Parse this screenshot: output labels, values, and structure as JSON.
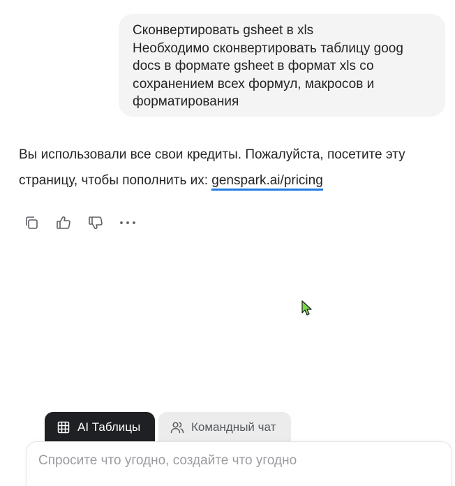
{
  "user_message": {
    "lines": [
      "Сконвертировать gsheet в xls",
      "Необходимо сконвертировать таблицу goog",
      "docs в формате gsheet в формат xls со",
      "сохранением всех формул, макросов и",
      "форматирования"
    ]
  },
  "assistant_message": {
    "line1": "Вы использовали все свои кредиты. Пожалуйста, посетите эту",
    "line2_prefix": "страницу, чтобы пополнить их: ",
    "link_text": "genspark.ai/pricing"
  },
  "actions": [
    {
      "icon": "copy-icon"
    },
    {
      "icon": "thumbs-up-icon"
    },
    {
      "icon": "thumbs-down-icon"
    },
    {
      "icon": "more-icon"
    }
  ],
  "tabs": [
    {
      "label": "AI Таблицы",
      "icon": "table-grid-icon",
      "active": true
    },
    {
      "label": "Командный чат",
      "icon": "users-icon",
      "active": false
    }
  ],
  "composer": {
    "placeholder": "Спросите что угодно, создайте что угодно",
    "value": ""
  },
  "colors": {
    "bubble_bg": "#f4f4f4",
    "link_underline": "#1d7ce0",
    "active_tab_bg": "#1f2023",
    "inactive_tab_bg": "#ececec",
    "cursor_fill": "#7bd84a"
  }
}
